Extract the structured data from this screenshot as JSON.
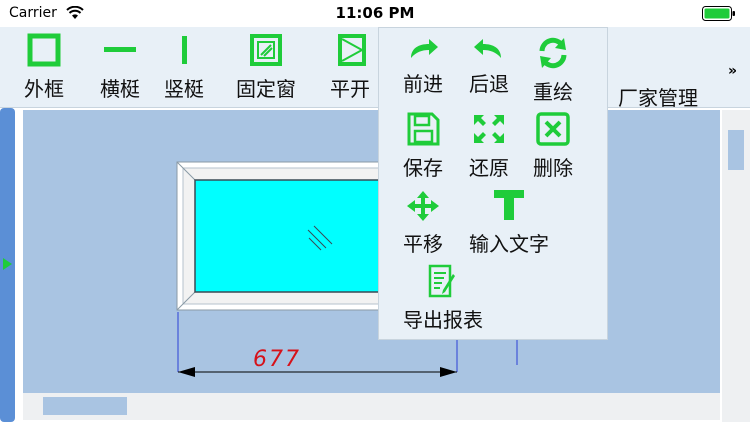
{
  "status": {
    "carrier": "Carrier",
    "time": "11:06 PM"
  },
  "toolbar": {
    "outer_frame": "外框",
    "horizontal_mullion": "横梃",
    "vertical_mullion": "竖梃",
    "fixed_window": "固定窗",
    "casement": "平开",
    "more": "»",
    "vendor_management": "厂家管理",
    "overflow": "»"
  },
  "popup": {
    "forward": "前进",
    "back": "后退",
    "redraw": "重绘",
    "save": "保存",
    "restore": "还原",
    "delete": "删除",
    "move": "平移",
    "input_text": "输入文字",
    "export_report": "导出报表"
  },
  "drawing": {
    "dimension": "677"
  },
  "colors": {
    "accent": "#1fcc3a",
    "canvas": "#a9c4e2",
    "glass": "#00ffff",
    "dimension": "#d6121a"
  }
}
